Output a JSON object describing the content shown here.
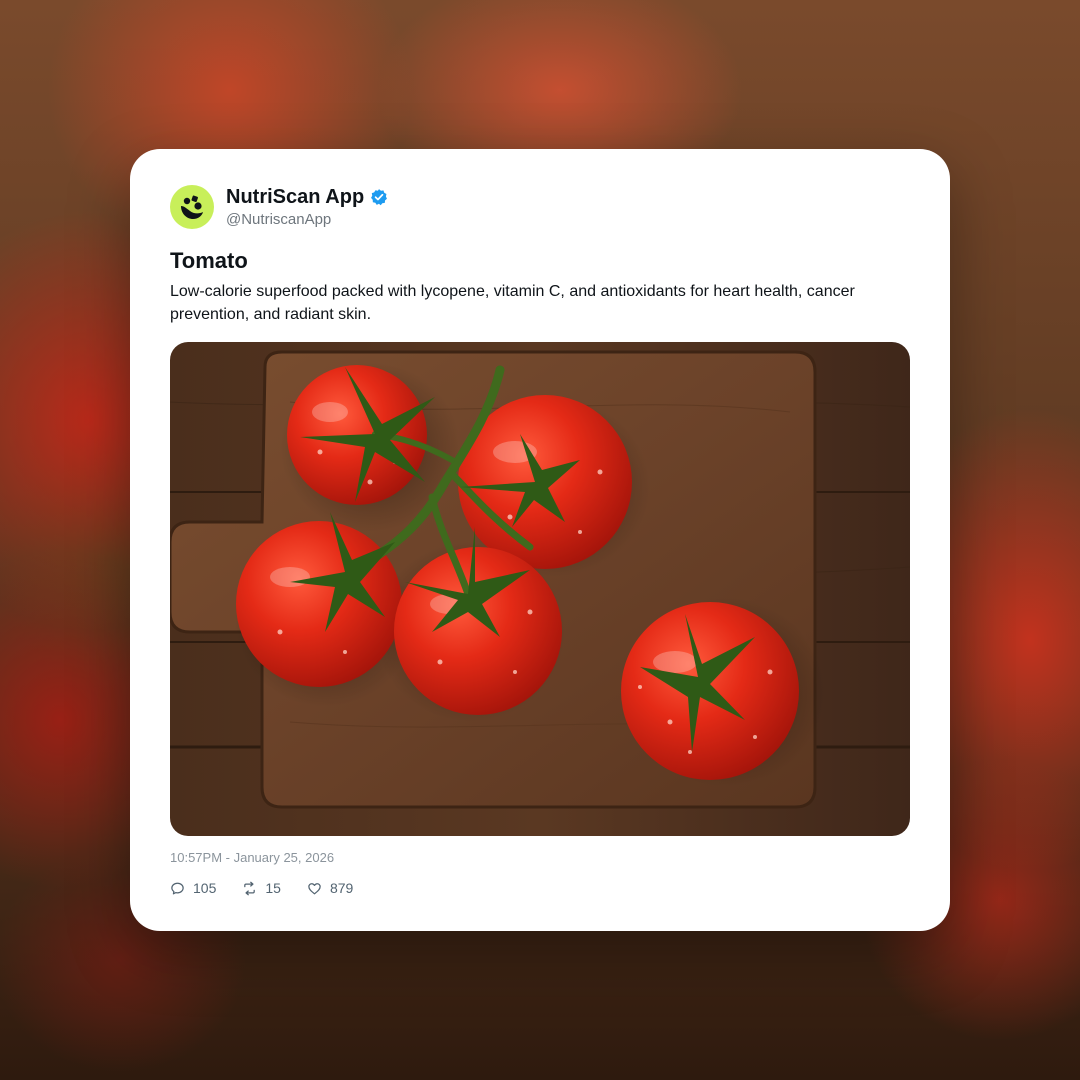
{
  "post": {
    "display_name": "NutriScan App",
    "handle": "@NutriscanApp",
    "verified": true,
    "title": "Tomato",
    "body": "Low-calorie superfood packed with lycopene, vitamin C, and antioxidants for heart health, cancer prevention, and radiant skin.",
    "timestamp": "10:57PM - January 25, 2026",
    "image": {
      "subject": "tomatoes on the vine on a wooden cutting board"
    }
  },
  "actions": {
    "replies": "105",
    "reposts": "15",
    "likes": "879"
  },
  "icons": {
    "avatar": "nutriscan-logo-icon",
    "verified": "verified-badge-icon",
    "reply": "comment-icon",
    "repost": "repost-icon",
    "like": "heart-icon"
  },
  "colors": {
    "avatar_bg": "#c8ef5a",
    "verified_blue": "#1d9bf0",
    "text_primary": "#0f1419",
    "text_secondary": "#6e767d"
  }
}
